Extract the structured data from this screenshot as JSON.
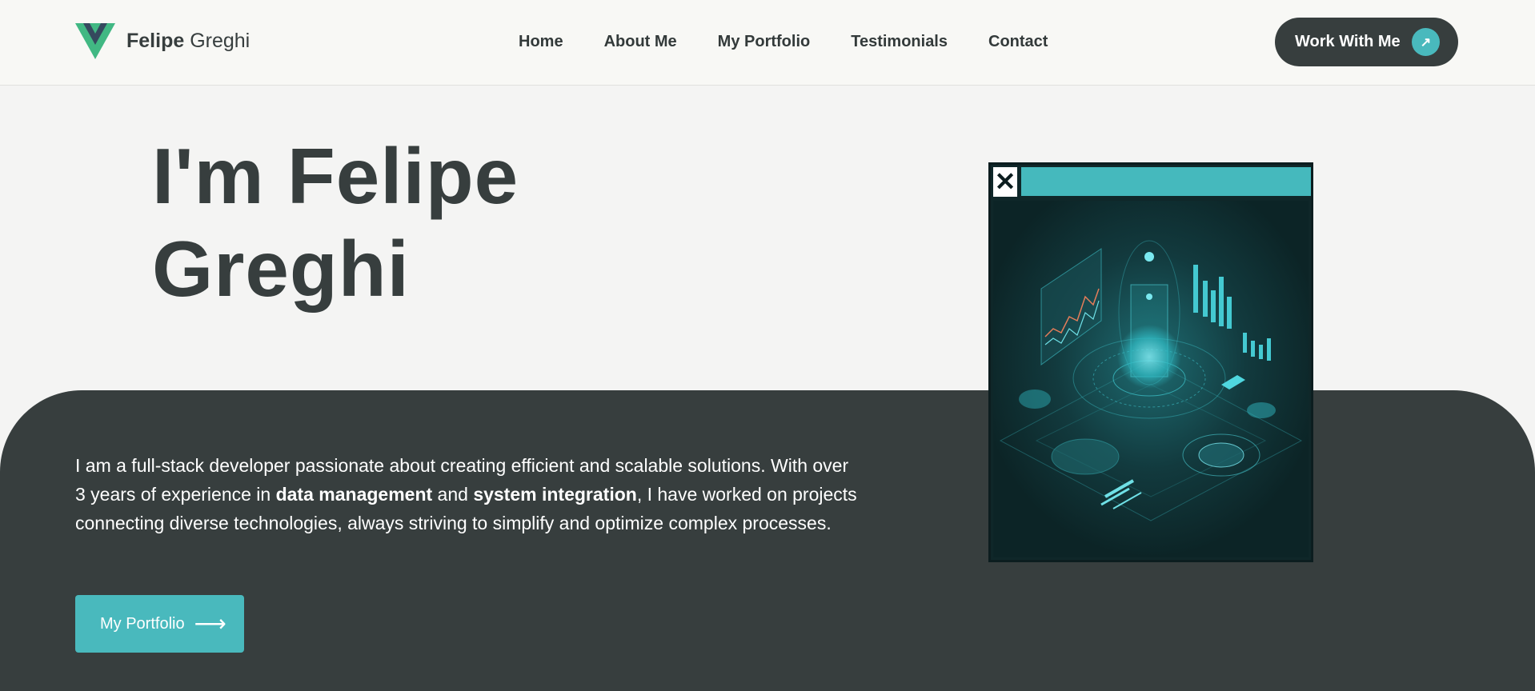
{
  "header": {
    "brand_first": "Felipe",
    "brand_last": "Greghi",
    "nav": [
      "Home",
      "About Me",
      "My Portfolio",
      "Testimonials",
      "Contact"
    ],
    "cta_label": "Work With Me",
    "cta_icon": "arrow-up-right-icon"
  },
  "hero": {
    "title_line1": "I'm Felipe",
    "title_line2": "Greghi",
    "intro_part1": "I am a full-stack developer passionate about creating efficient and scalable solutions. With over 3 years of experience in ",
    "intro_bold1": "data management",
    "intro_part2": " and ",
    "intro_bold2": "system integration",
    "intro_part3": ", I have worked on projects connecting diverse technologies, always striving to simplify and optimize complex processes.",
    "portfolio_label": "My Portfolio",
    "portfolio_arrow": "⟶"
  },
  "card": {
    "close_glyph": "✕",
    "image_alt": "isometric data dashboard illustration"
  },
  "colors": {
    "accent": "#49b9bd",
    "dark": "#373e3e",
    "background": "#f4f4f3"
  }
}
